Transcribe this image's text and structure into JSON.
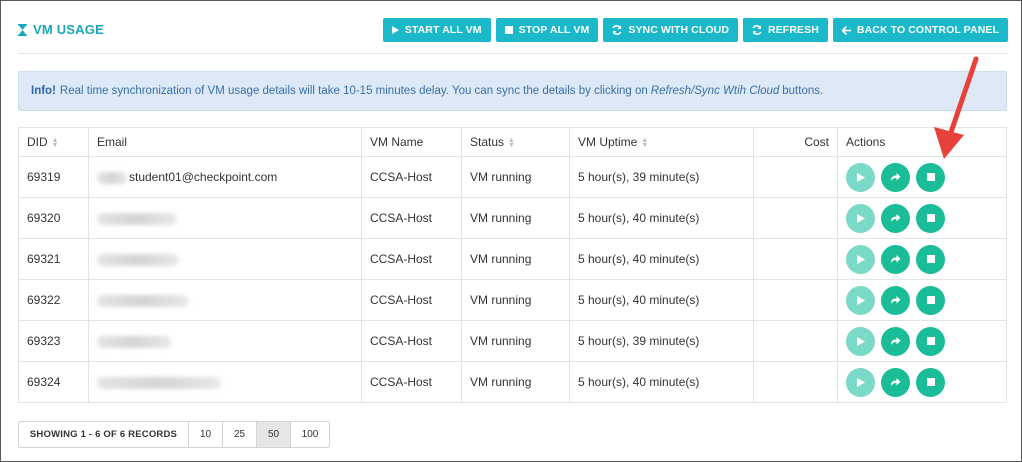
{
  "header": {
    "title": "VM USAGE",
    "buttons": {
      "start_all": "START ALL VM",
      "stop_all": "STOP ALL VM",
      "sync": "SYNC WITH CLOUD",
      "refresh": "REFRESH",
      "back": "BACK TO CONTROL PANEL"
    }
  },
  "info": {
    "label": "Info!",
    "text_before": "Real time synchronization of VM usage details will take 10-15 minutes delay. You can sync the details by clicking on",
    "text_italic": "Refresh/Sync Wtih Cloud",
    "text_after": "buttons."
  },
  "table": {
    "columns": [
      "DID",
      "Email",
      "VM Name",
      "Status",
      "VM Uptime",
      "Cost",
      "Actions"
    ],
    "rows": [
      {
        "did": "69319",
        "email": "student01@checkpoint.com",
        "vm_name": "CCSA-Host",
        "status": "VM running",
        "uptime": "5 hour(s), 39 minute(s)",
        "cost": ""
      },
      {
        "did": "69320",
        "email": "",
        "vm_name": "CCSA-Host",
        "status": "VM running",
        "uptime": "5 hour(s), 40 minute(s)",
        "cost": ""
      },
      {
        "did": "69321",
        "email": "",
        "vm_name": "CCSA-Host",
        "status": "VM running",
        "uptime": "5 hour(s), 40 minute(s)",
        "cost": ""
      },
      {
        "did": "69322",
        "email": "",
        "vm_name": "CCSA-Host",
        "status": "VM running",
        "uptime": "5 hour(s), 40 minute(s)",
        "cost": ""
      },
      {
        "did": "69323",
        "email": "",
        "vm_name": "CCSA-Host",
        "status": "VM running",
        "uptime": "5 hour(s), 39 minute(s)",
        "cost": ""
      },
      {
        "did": "69324",
        "email": "",
        "vm_name": "CCSA-Host",
        "status": "VM running",
        "uptime": "5 hour(s), 40 minute(s)",
        "cost": ""
      }
    ]
  },
  "pager": {
    "records": "SHOWING 1 - 6 OF 6 RECORDS",
    "sizes": [
      "10",
      "25",
      "50",
      "100"
    ],
    "selected": "50"
  },
  "colors": {
    "accent": "#1ab8c9",
    "action_green": "#1bbc98",
    "action_play": "#7bd9c7",
    "annotation_arrow": "#e8413c"
  }
}
